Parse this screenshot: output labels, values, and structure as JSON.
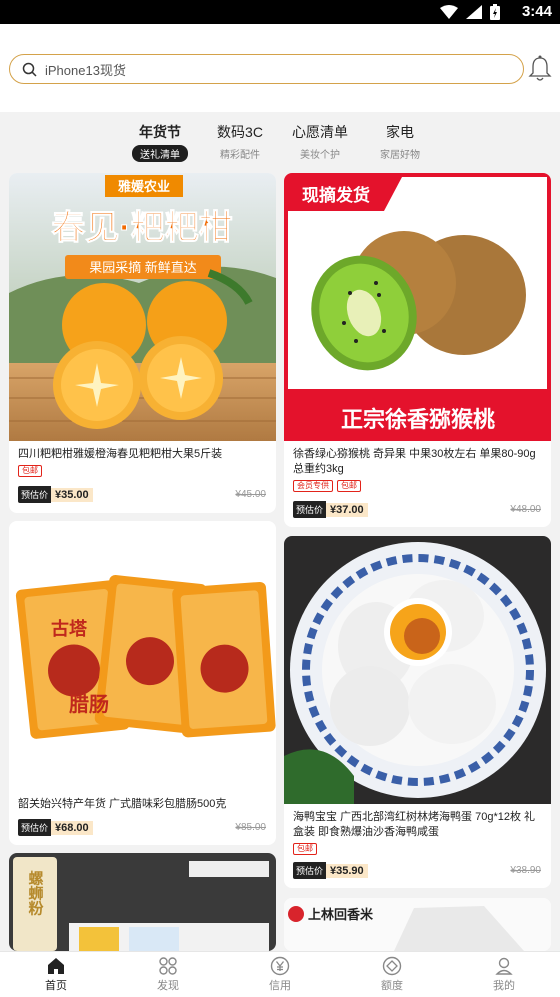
{
  "status_bar": {
    "time": "3:44"
  },
  "search": {
    "placeholder": "iPhone13现货"
  },
  "tabs": [
    {
      "title": "年货节",
      "sub": "送礼清单",
      "active": true
    },
    {
      "title": "数码3C",
      "sub": "精彩配件"
    },
    {
      "title": "心愿清单",
      "sub": "美妆个护"
    },
    {
      "title": "家电",
      "sub": "家居好物"
    }
  ],
  "products": [
    {
      "name": "四川粑粑柑雅媛橙海春见粑粑柑大果5斤装",
      "tags": [
        "包邮"
      ],
      "price_label": "预估价",
      "price": "¥35.00",
      "original": "¥45.00",
      "banner_brand": "雅媛农业",
      "banner_title": "春见·粑粑柑",
      "banner_sub": "果园采摘 新鲜直达"
    },
    {
      "name": "徐香绿心猕猴桃 奇异果 中果30枚左右 单果80-90g 总重约3kg",
      "tags": [
        "会员专供",
        "包邮"
      ],
      "price_label": "预估价",
      "price": "¥37.00",
      "original": "¥48.00",
      "banner_top": "现摘发货",
      "banner_bottom": "正宗徐香猕猴桃"
    },
    {
      "name": "韶关始兴特产年货 广式腊味彩包腊肠500克",
      "tags": [],
      "price_label": "预估价",
      "price": "¥68.00",
      "original": "¥85.00",
      "pack_text": "古塔",
      "pack_text2": "腊肠"
    },
    {
      "name": "海鸭宝宝 广西北部湾红树林烤海鸭蛋 70g*12枚 礼盒装 即食熟爆油沙香海鸭咸蛋",
      "tags": [
        "包邮"
      ],
      "price_label": "预估价",
      "price": "¥35.90",
      "original": "¥38.90"
    },
    {
      "name": "",
      "banner_text": "螺蛳粉"
    },
    {
      "name": "",
      "banner_text": "上林回香米"
    }
  ],
  "nav": [
    {
      "label": "首页",
      "icon": "home-icon",
      "active": true
    },
    {
      "label": "发现",
      "icon": "discover-icon"
    },
    {
      "label": "信用",
      "icon": "credit-icon"
    },
    {
      "label": "额度",
      "icon": "quota-icon"
    },
    {
      "label": "我的",
      "icon": "profile-icon"
    }
  ],
  "colors": {
    "accent_gold": "#d4a24a",
    "tag_red": "#e2231a",
    "price_bg": "#fbe7c8"
  }
}
